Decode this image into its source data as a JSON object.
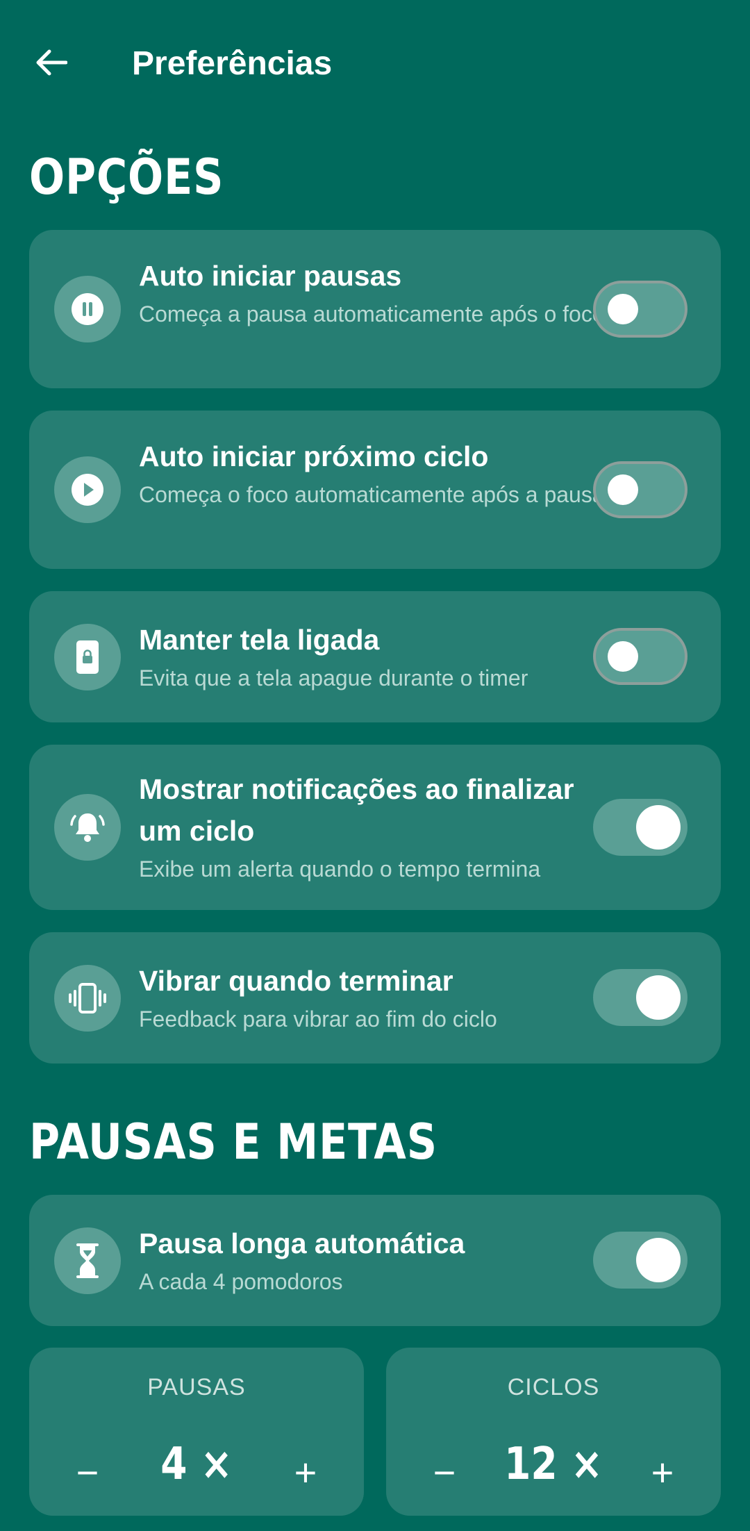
{
  "header": {
    "title": "Preferências"
  },
  "sections": {
    "options": "OPÇÕES",
    "breaks": "PAUSAS E METAS"
  },
  "options": [
    {
      "title": "Auto iniciar pausas",
      "subtitle": "Começa a pausa automaticamente após o foco",
      "enabled": false,
      "icon": "pause-circle-icon"
    },
    {
      "title": "Auto iniciar próximo ciclo",
      "subtitle": "Começa o foco automaticamente após a pausa",
      "enabled": false,
      "icon": "play-circle-icon"
    },
    {
      "title": "Manter tela ligada",
      "subtitle": "Evita que a tela apague durante o timer",
      "enabled": false,
      "icon": "phone-lock-icon"
    },
    {
      "title": "Mostrar notificações ao finalizar um ciclo",
      "subtitle": "Exibe um alerta quando o tempo termina",
      "enabled": true,
      "icon": "notification-bell-icon"
    },
    {
      "title": "Vibrar quando terminar",
      "subtitle": "Feedback para vibrar ao fim do ciclo",
      "enabled": true,
      "icon": "vibrate-icon"
    }
  ],
  "long_break": {
    "title": "Pausa longa automática",
    "subtitle": "A cada 4 pomodoros",
    "enabled": true,
    "icon": "hourglass-icon"
  },
  "steppers": {
    "pauses": {
      "label": "PAUSAS",
      "value": "4 ×",
      "minus": "−",
      "plus": "+"
    },
    "cycles": {
      "label": "CICLOS",
      "value": "12 ×",
      "minus": "−",
      "plus": "+"
    }
  },
  "colors": {
    "background": "#00695c",
    "card": "#267e73",
    "icon_bg": "#5a9f95",
    "subtitle": "#b9dad4"
  }
}
